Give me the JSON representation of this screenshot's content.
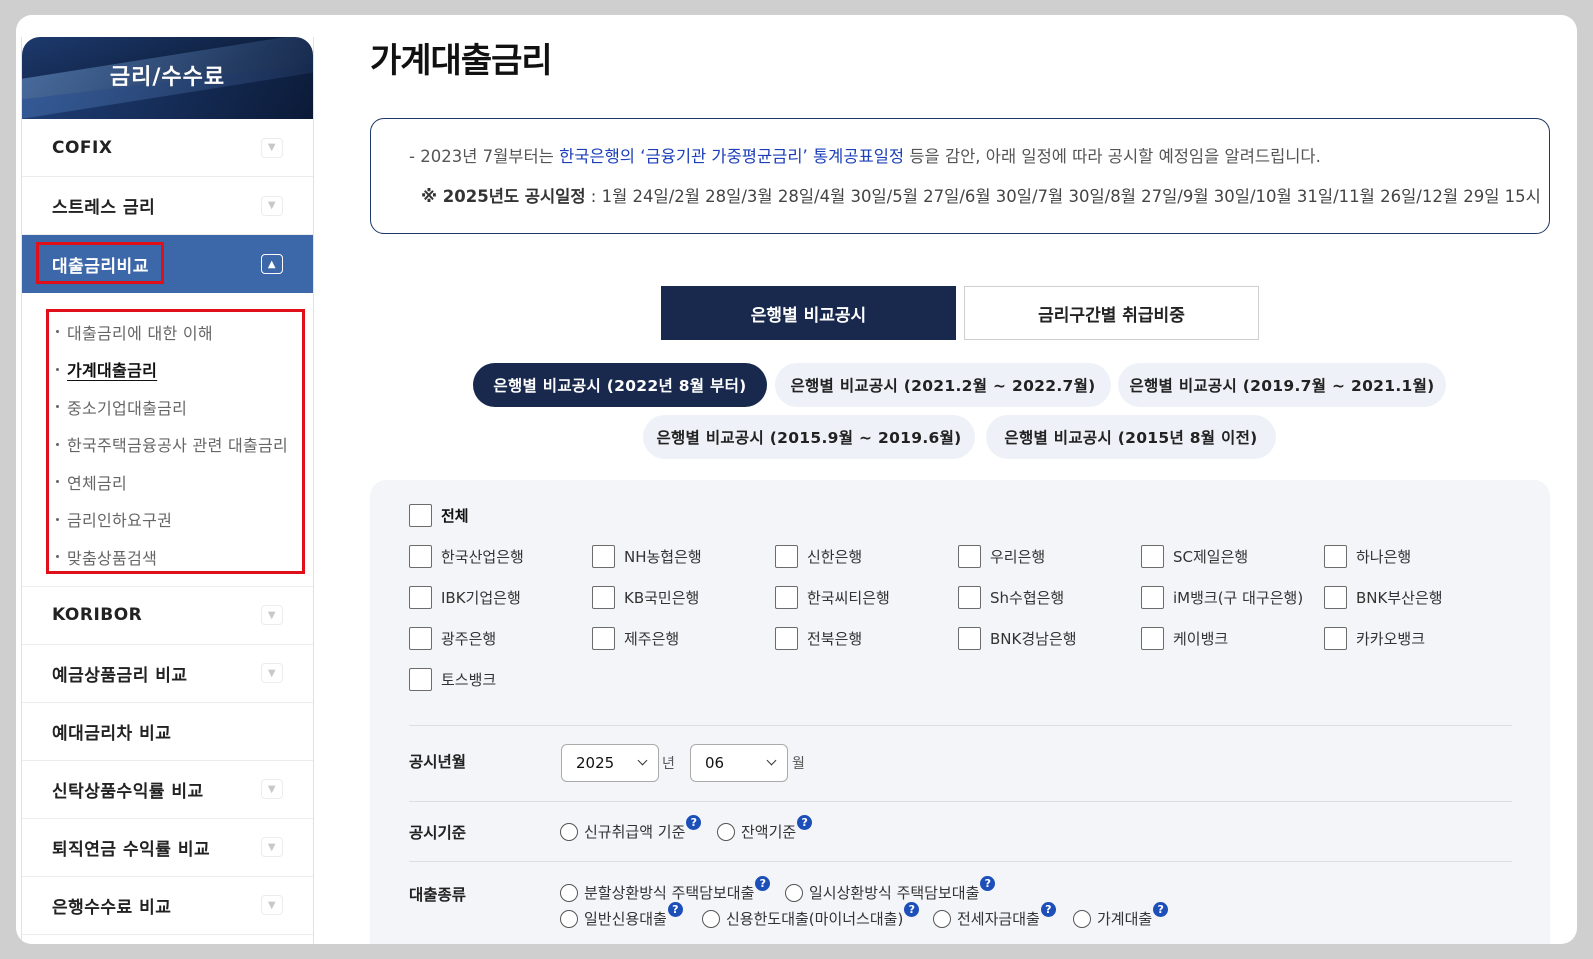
{
  "sidebar": {
    "title": "금리/수수료",
    "items_top": [
      {
        "label": "COFIX",
        "chevron": "chevron-down-icon"
      },
      {
        "label": "스트레스 금리",
        "chevron": "chevron-down-icon"
      },
      {
        "label": "대출금리비교",
        "chevron": "chevron-up-icon",
        "active": true
      }
    ],
    "submenu": [
      "대출금리에 대한 이해",
      "가계대출금리",
      "중소기업대출금리",
      "한국주택금융공사 관련 대출금리",
      "연체금리",
      "금리인하요구권",
      "맞춤상품검색"
    ],
    "items_bottom": [
      {
        "label": "KORIBOR",
        "chevron": "chevron-down-icon"
      },
      {
        "label": "예금상품금리 비교",
        "chevron": "chevron-down-icon"
      },
      {
        "label": "예대금리차 비교",
        "chevron": ""
      },
      {
        "label": "신탁상품수익률 비교",
        "chevron": "chevron-down-icon"
      },
      {
        "label": "퇴직연금 수익률 비교",
        "chevron": "chevron-down-icon"
      },
      {
        "label": "은행수수료 비교",
        "chevron": "chevron-down-icon"
      }
    ]
  },
  "page": {
    "title": "가계대출금리"
  },
  "notice": {
    "line1_pre": "- 2023년 7월부터는 ",
    "line1_link": "한국은행의 ‘금융기관 가중평균금리’ 통계공표일정",
    "line1_post": " 등을 감안, 아래 일정에 따라 공시할 예정임을 알려드립니다.",
    "line2_bold": "※ 2025년도 공시일정",
    "line2_rest": " : 1월 24일/2월 28일/3월 28일/4월 30일/5월 27일/6월 30일/7월 30일/8월 27일/9월 30일/10월 31일/11월 26일/12월 29일 15시"
  },
  "tabs": {
    "main": "은행별 비교공시",
    "secondary": "금리구간별 취급비중"
  },
  "period_pills": [
    {
      "label": "은행별 비교공시 (2022년 8월 부터)",
      "active": true
    },
    {
      "label": "은행별 비교공시 (2021.2월 ~ 2022.7월)",
      "active": false
    },
    {
      "label": "은행별 비교공시 (2019.7월 ~ 2021.1월)",
      "active": false
    },
    {
      "label": "은행별 비교공시 (2015.9월 ~ 2019.6월)",
      "active": false
    },
    {
      "label": "은행별 비교공시 (2015년 8월 이전)",
      "active": false
    }
  ],
  "banks": {
    "all_label": "전체",
    "list": [
      "한국산업은행",
      "NH농협은행",
      "신한은행",
      "우리은행",
      "SC제일은행",
      "하나은행",
      "IBK기업은행",
      "KB국민은행",
      "한국씨티은행",
      "Sh수협은행",
      "iM뱅크(구 대구은행)",
      "BNK부산은행",
      "광주은행",
      "제주은행",
      "전북은행",
      "BNK경남은행",
      "케이뱅크",
      "카카오뱅크",
      "토스뱅크"
    ]
  },
  "filters": {
    "year_month": {
      "label": "공시년월",
      "year": "2025",
      "year_unit": "년",
      "month": "06",
      "month_unit": "월"
    },
    "basis": {
      "label": "공시기준",
      "options": [
        "신규취급액 기준",
        "잔액기준"
      ]
    },
    "loan_type": {
      "label": "대출종류",
      "options": [
        "분할상환방식 주택담보대출",
        "일시상환방식 주택담보대출",
        "일반신용대출",
        "신용한도대출(마이너스대출)",
        "전세자금대출",
        "가계대출"
      ]
    },
    "help_glyph": "?"
  },
  "colors": {
    "navy": "#18294d",
    "sidebar_active": "#3c68a9",
    "highlight_box": "#e0101a",
    "link_blue": "#1b3fb8",
    "panel_bg": "#f4f5f8"
  }
}
